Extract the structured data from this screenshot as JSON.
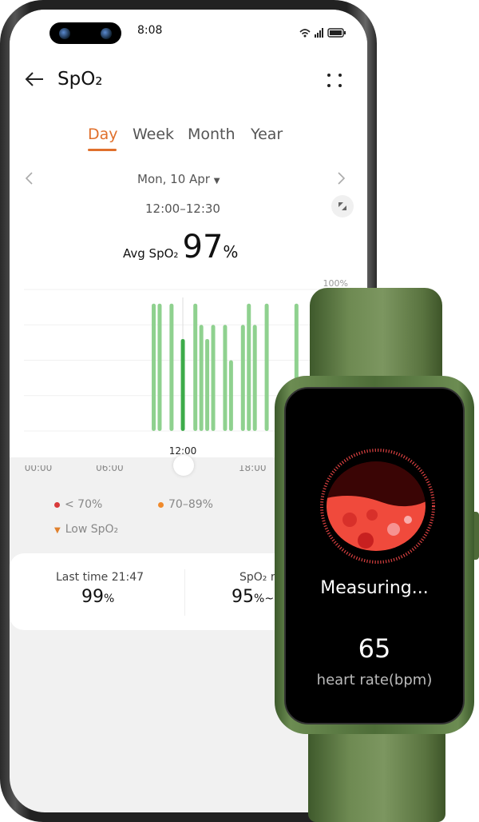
{
  "status_bar": {
    "time": "8:08",
    "icons": [
      "wifi-icon",
      "4g-signal-icon",
      "battery-icon"
    ]
  },
  "header": {
    "title": "SpO₂",
    "back_icon": "arrow-left-icon",
    "more_icon": "four-dots-icon"
  },
  "tabs": [
    {
      "label": "Day",
      "active": true
    },
    {
      "label": "Week"
    },
    {
      "label": "Month"
    },
    {
      "label": "Year"
    }
  ],
  "date_nav": {
    "date": "Mon, 10 Apr",
    "prev_icon": "chevron-left-icon",
    "next_icon": "chevron-right-icon"
  },
  "summary": {
    "time_range": "12:00–12:30",
    "avg_label": "Avg SpO₂",
    "avg_value": "97",
    "unit": "%"
  },
  "colors": {
    "accent": "#e0702c",
    "bar": "#8fd18f",
    "bar_selected": "#3dab4a",
    "low": "#d93a3a",
    "mid": "#f08a2c"
  },
  "chart_data": {
    "type": "bar",
    "y_tick_label": "100%",
    "x_ticks": [
      "00:00",
      "06:00",
      "12:00",
      "18:00"
    ],
    "selected_label": "12:00",
    "selected_hour": 12.15,
    "ylim": [
      80,
      100
    ],
    "grid": true,
    "points": [
      {
        "hour": 9.7,
        "value": 98
      },
      {
        "hour": 10.2,
        "value": 98
      },
      {
        "hour": 11.2,
        "value": 98
      },
      {
        "hour": 12.15,
        "value": 93
      },
      {
        "hour": 13.2,
        "value": 98
      },
      {
        "hour": 13.7,
        "value": 95
      },
      {
        "hour": 14.2,
        "value": 93
      },
      {
        "hour": 14.7,
        "value": 95
      },
      {
        "hour": 15.7,
        "value": 95
      },
      {
        "hour": 16.2,
        "value": 90
      },
      {
        "hour": 17.2,
        "value": 95
      },
      {
        "hour": 17.7,
        "value": 98
      },
      {
        "hour": 18.2,
        "value": 95
      },
      {
        "hour": 19.2,
        "value": 98
      },
      {
        "hour": 21.7,
        "value": 98
      }
    ]
  },
  "legend": [
    {
      "label": "< 70%",
      "color": "#d93a3a"
    },
    {
      "label": "70–89%",
      "color": "#f08a2c"
    },
    {
      "label": "Low SpO₂",
      "color": "#e0802c"
    }
  ],
  "stats": {
    "last_label": "Last time 21:47",
    "last_value": "99",
    "range_label": "SpO₂ r",
    "range_value": "95",
    "unit": "%",
    "range_suffix": "~"
  },
  "watch": {
    "status": "Measuring...",
    "value": "65",
    "label": "heart rate(bpm)"
  }
}
